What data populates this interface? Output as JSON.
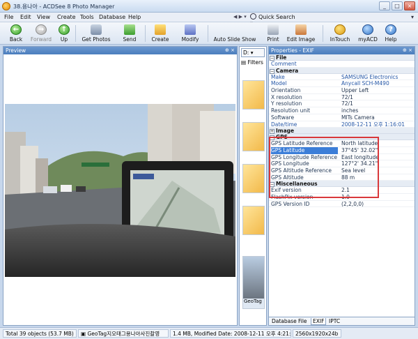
{
  "window": {
    "title": "38.용나아 - ACDSee 8 Photo Manager",
    "controls": [
      "_",
      "□",
      "×"
    ]
  },
  "menubar": {
    "items": [
      "File",
      "Edit",
      "View",
      "Create",
      "Tools",
      "Database",
      "Help"
    ],
    "quick_search": "Quick Search"
  },
  "toolbar": {
    "back": "Back",
    "forward": "Forward",
    "up": "Up",
    "get_photos": "Get Photos",
    "send": "Send",
    "create": "Create",
    "modify": "Modify",
    "auto_slide_show": "Auto Slide Show",
    "print": "Print",
    "edit_image": "Edit Image",
    "intouch": "InTouch",
    "myacd": "myACD",
    "help": "Help"
  },
  "preview": {
    "title": "Preview"
  },
  "browser": {
    "drive": "D:",
    "filters": "Filters",
    "thumb_label": "GeoTag"
  },
  "properties": {
    "title": "Properties - EXIF",
    "sections": {
      "file": "File",
      "camera": "Camera",
      "image": "Image",
      "gps": "GPS",
      "misc": "Miscellaneous"
    },
    "file_rows": [
      {
        "k": "Comment",
        "v": ""
      }
    ],
    "camera_rows": [
      {
        "k": "Make",
        "v": "SAMSUNG Electronics"
      },
      {
        "k": "Model",
        "v": "Anycall SCH-M490"
      },
      {
        "k": "Orientation",
        "v": "Upper Left"
      },
      {
        "k": "X resolution",
        "v": "72/1"
      },
      {
        "k": "Y resolution",
        "v": "72/1"
      },
      {
        "k": "Resolution unit",
        "v": "inches"
      },
      {
        "k": "Software",
        "v": "MITs Camera"
      },
      {
        "k": "Date/time",
        "v": "2008-12-11 오후 1:16:01"
      }
    ],
    "gps_rows": [
      {
        "k": "GPS Latitude Reference",
        "v": "North latitude"
      },
      {
        "k": "GPS Latitude",
        "v": "37°45' 32.02\""
      },
      {
        "k": "GPS Longitude Reference",
        "v": "East longitude"
      },
      {
        "k": "GPS Longitude",
        "v": "127°2' 34.21\""
      },
      {
        "k": "GPS Altitude Reference",
        "v": "Sea level"
      },
      {
        "k": "GPS Altitude",
        "v": "88 m"
      }
    ],
    "misc_rows": [
      {
        "k": "Exif version",
        "v": "2.1"
      },
      {
        "k": "FlashPix version",
        "v": "1.0"
      },
      {
        "k": "GPS Version ID",
        "v": "(2,2,0,0)"
      }
    ],
    "tabs": [
      "Database",
      "File",
      "EXIF",
      "IPTC"
    ]
  },
  "status": {
    "total": "Total 39 objects  (53.7 MB)",
    "file": "GeoTag지오태그용나아사진촬영",
    "details": "1.4 MB, Modified Date: 2008-12-11 오후 4:21:36",
    "dims": "2560x1920x24b"
  }
}
